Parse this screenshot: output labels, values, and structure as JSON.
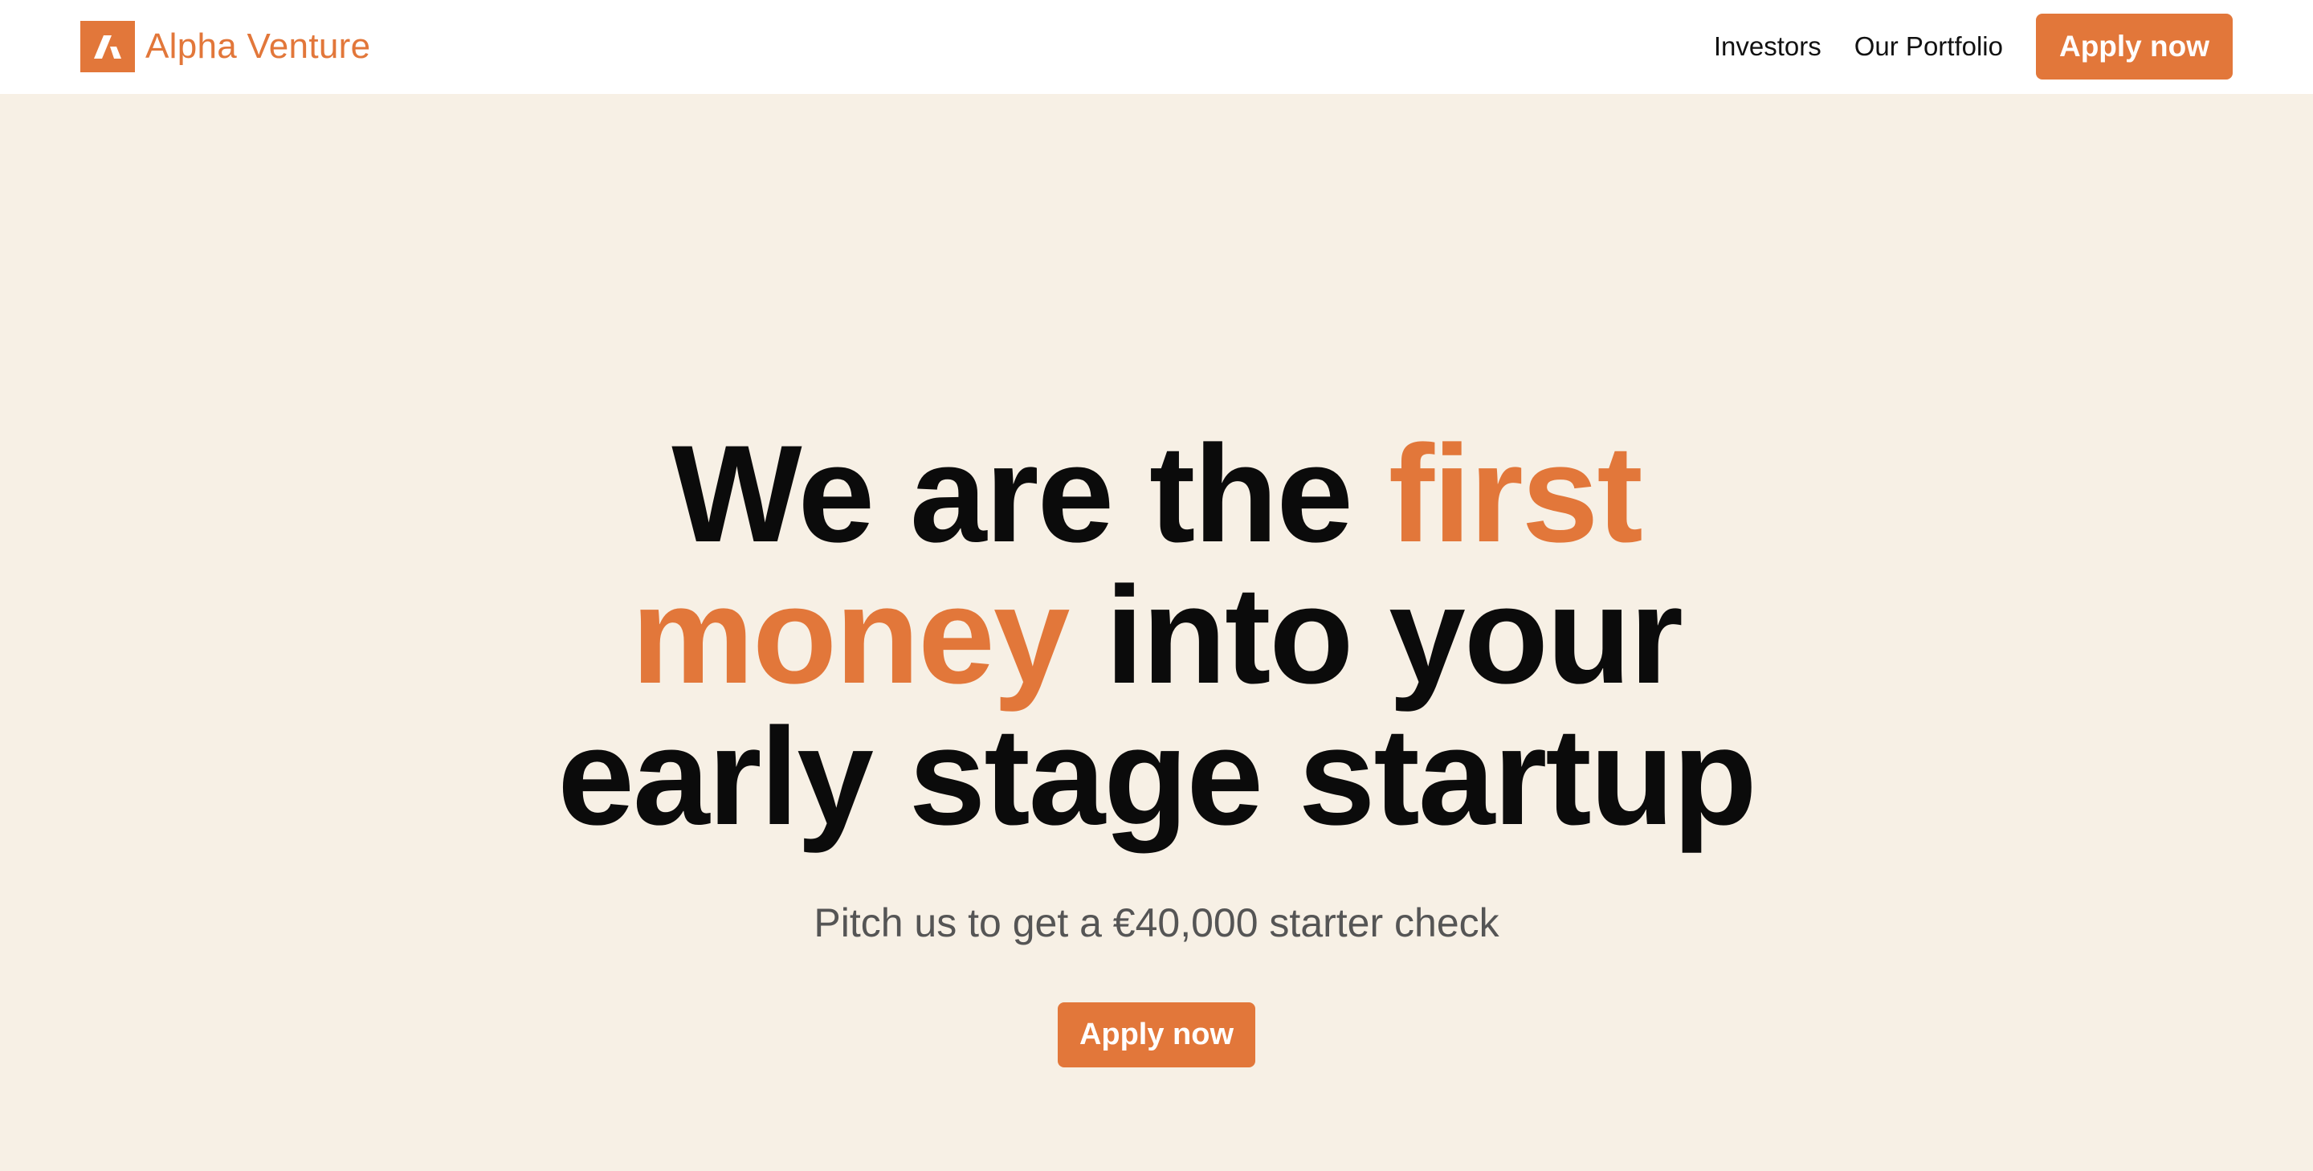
{
  "header": {
    "brand": "Alpha Venture",
    "nav": {
      "investors": "Investors",
      "portfolio": "Our Portfolio",
      "cta": "Apply now"
    }
  },
  "hero": {
    "headline": {
      "part1": "We are the ",
      "accent1": "first",
      "accent2": "money",
      "part2": " into your",
      "part3": "early stage startup"
    },
    "subtitle": "Pitch us to get a €40,000 starter check",
    "cta": "Apply now"
  },
  "colors": {
    "accent": "#E2773A",
    "background": "#F7F0E5",
    "header_bg": "#FFFFFF",
    "text": "#0B0B0B",
    "muted_text": "#555555"
  },
  "icons": {
    "logo": "alpha-venture-logo-icon"
  }
}
